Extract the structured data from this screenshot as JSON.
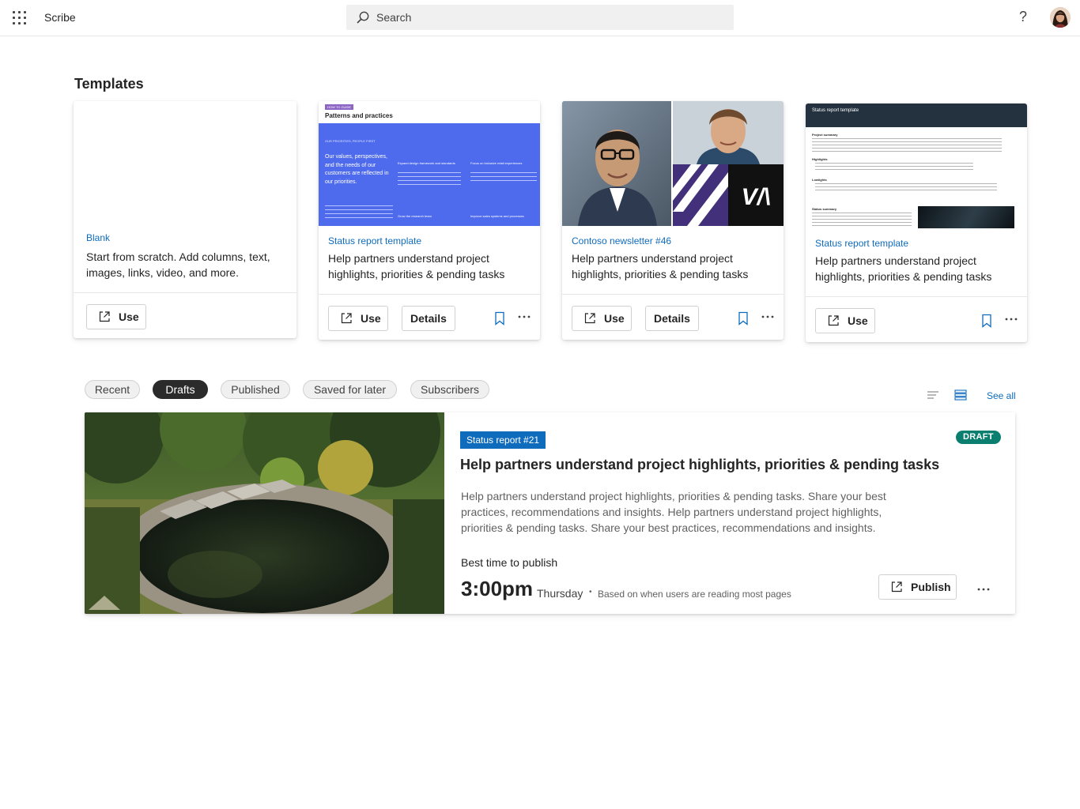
{
  "header": {
    "app_name": "Scribe",
    "search_placeholder": "Search",
    "help_label": "?"
  },
  "templates": {
    "title": "Templates",
    "cards": [
      {
        "kicker": "Blank",
        "description": "Start from scratch. Add columns, text, images, links, video, and more.",
        "use_label": "Use"
      },
      {
        "kicker": "Status report template",
        "description": "Help partners understand project highlights, priorities & pending tasks",
        "use_label": "Use",
        "details_label": "Details",
        "thumb": {
          "badge": "HOW TO GUIDE",
          "title": "Patterns and practices",
          "band_heading": "OUR PRIORITIES, PEOPLE FIRST",
          "big_text": "Our values, perspectives, and the needs of our customers are reflected in our priorities.",
          "col2_title": "Expand design framework and standards",
          "col3_title": "Focus on inclusive retail experiences",
          "col2_footer": "Grow the research team",
          "col3_footer": "Improve sales systems and processes"
        }
      },
      {
        "kicker": "Contoso newsletter #46",
        "description": "Help partners understand project highlights, priorities & pending tasks",
        "use_label": "Use",
        "details_label": "Details",
        "thumb": {
          "logo": "V/\\"
        }
      },
      {
        "kicker": "Status report template",
        "description": "Help partners understand project highlights, priorities & pending tasks",
        "use_label": "Use",
        "thumb": {
          "title": "Status report template",
          "s1": "Project summary",
          "s2": "Highlights",
          "s3": "Lowlights",
          "s4": "Status summary"
        }
      }
    ]
  },
  "filters": {
    "pills": [
      "Recent",
      "Drafts",
      "Published",
      "Saved for later",
      "Subscribers"
    ],
    "active": "Drafts",
    "see_all": "See all"
  },
  "draft": {
    "tag": "Status report #21",
    "badge": "DRAFT",
    "title": "Help partners understand project highlights, priorities & pending tasks",
    "body": "Help partners understand project highlights, priorities & pending tasks. Share your best practices, recommendations and insights. Help partners understand project highlights, priorities & pending tasks. Share your best practices, recommendations and insights.",
    "best_time_label": "Best time to publish",
    "time": "3:00pm",
    "day": "Thursday",
    "dot": "•",
    "note": "Based on when users are reading most pages",
    "publish_label": "Publish"
  },
  "colors": {
    "accent": "#0f6cbd",
    "draft_badge": "#0b7f6f",
    "template_band": "#4f6bed"
  }
}
